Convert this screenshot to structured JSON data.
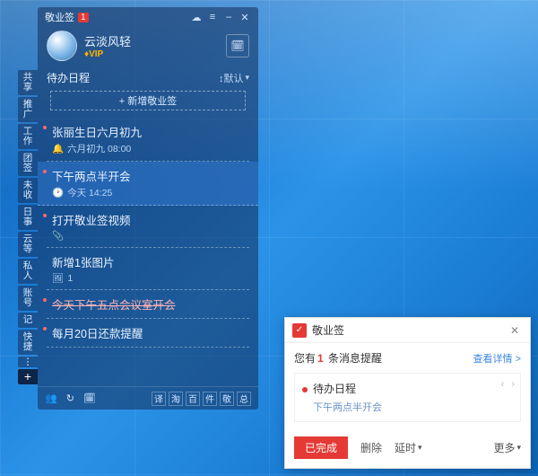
{
  "app": {
    "name": "敬业签",
    "badge_count": "1"
  },
  "user": {
    "name": "云淡风轻",
    "vip_label": "♦VIP"
  },
  "header": {
    "tab": "待办日程",
    "sort": "↕默认",
    "add_label": "+ 新增敬业签"
  },
  "sidebar_tabs": [
    "共享",
    "推广",
    "工作",
    "团签",
    "未收",
    "日事",
    "云等",
    "私人",
    "账号",
    "记",
    "快捷"
  ],
  "items": [
    {
      "title": "张丽生日六月初九",
      "meta_icon": "bell",
      "meta": "六月初九 08:00",
      "dot": true
    },
    {
      "title": "下午两点半开会",
      "meta_icon": "clock",
      "meta": "今天 14:25",
      "dot": true,
      "selected": true
    },
    {
      "title": "打开敬业签视频",
      "meta_icon": "paperclip",
      "meta": "",
      "dot": true
    },
    {
      "title": "新增1张图片",
      "meta_icon": "image",
      "meta": "1",
      "dot": false
    },
    {
      "title": "今天下午五点会议室开会",
      "strike": true,
      "dot": true
    },
    {
      "title": "每月20日还款提醒",
      "dot": true
    }
  ],
  "bottom_pills": [
    "译",
    "淘",
    "百",
    "件",
    "敬",
    "总"
  ],
  "notif": {
    "app": "敬业签",
    "summary_pre": "您有",
    "count": "1",
    "summary_post": " 条消息提醒",
    "view": "查看详情 >",
    "card_title": "待办日程",
    "card_sub": "下午两点半开会",
    "btn_done": "已完成",
    "btn_delete": "删除",
    "btn_delay": "延时",
    "btn_more": "更多"
  }
}
